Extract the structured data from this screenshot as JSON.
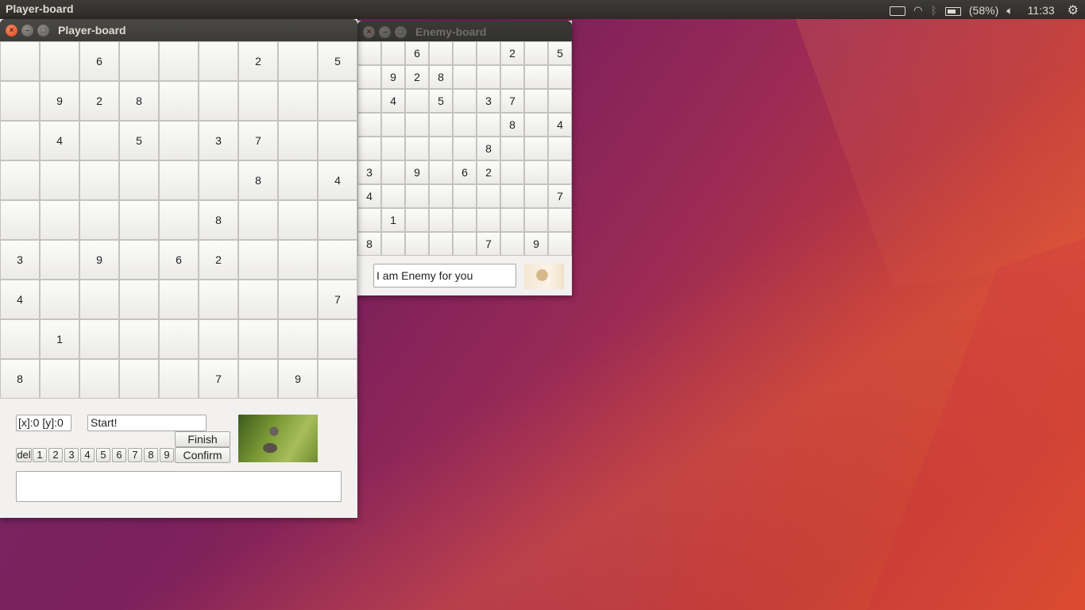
{
  "top_panel": {
    "app_title": "Player-board",
    "battery_text": "(58%)",
    "clock": "11:33"
  },
  "player_window": {
    "title": "Player-board",
    "grid": [
      [
        "",
        "",
        "6",
        "",
        "",
        "",
        "2",
        "",
        "5"
      ],
      [
        "",
        "9",
        "2",
        "8",
        "",
        "",
        "",
        "",
        ""
      ],
      [
        "",
        "4",
        "",
        "5",
        "",
        "3",
        "7",
        "",
        ""
      ],
      [
        "",
        "",
        "",
        "",
        "",
        "",
        "8",
        "",
        "4"
      ],
      [
        "",
        "",
        "",
        "",
        "",
        "8",
        "",
        "",
        ""
      ],
      [
        "3",
        "",
        "9",
        "",
        "6",
        "2",
        "",
        "",
        ""
      ],
      [
        "4",
        "",
        "",
        "",
        "",
        "",
        "",
        "",
        "7"
      ],
      [
        "",
        "1",
        "",
        "",
        "",
        "",
        "",
        "",
        ""
      ],
      [
        "8",
        "",
        "",
        "",
        "",
        "7",
        "",
        "9",
        ""
      ]
    ],
    "coords_value": "[x]:0 [y]:0",
    "status_value": "Start!",
    "finish_label": "Finish",
    "confirm_label": "Confirm",
    "del_label": "del",
    "number_buttons": [
      "1",
      "2",
      "3",
      "4",
      "5",
      "6",
      "7",
      "8",
      "9"
    ],
    "message_value": ""
  },
  "enemy_window": {
    "title": "Enemy-board",
    "grid": [
      [
        "",
        "",
        "6",
        "",
        "",
        "",
        "2",
        "",
        "5"
      ],
      [
        "",
        "9",
        "2",
        "8",
        "",
        "",
        "",
        "",
        ""
      ],
      [
        "",
        "4",
        "",
        "5",
        "",
        "3",
        "7",
        "",
        ""
      ],
      [
        "",
        "",
        "",
        "",
        "",
        "",
        "8",
        "",
        "4"
      ],
      [
        "",
        "",
        "",
        "",
        "",
        "8",
        "",
        "",
        ""
      ],
      [
        "3",
        "",
        "9",
        "",
        "6",
        "2",
        "",
        "",
        ""
      ],
      [
        "4",
        "",
        "",
        "",
        "",
        "",
        "",
        "",
        "7"
      ],
      [
        "",
        "1",
        "",
        "",
        "",
        "",
        "",
        "",
        ""
      ],
      [
        "8",
        "",
        "",
        "",
        "",
        "7",
        "",
        "9",
        ""
      ]
    ],
    "enemy_message": "I am Enemy for you"
  }
}
